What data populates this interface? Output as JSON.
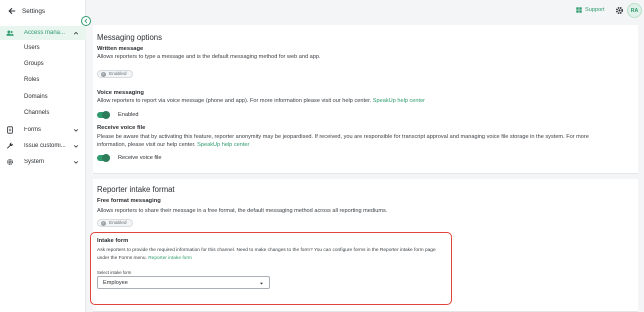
{
  "sidebar": {
    "back_label": "Settings",
    "items": [
      {
        "label": "Access mana...",
        "icon": "users-icon",
        "expanded": true
      },
      {
        "label": "Forms",
        "icon": "document-icon"
      },
      {
        "label": "Issue customi...",
        "icon": "wrench-icon"
      },
      {
        "label": "System",
        "icon": "gear-icon"
      }
    ],
    "sub_items": [
      "Users",
      "Groups",
      "Roles",
      "Domains",
      "Channels"
    ]
  },
  "topbar": {
    "support_label": "Support",
    "avatar_initials": "RA"
  },
  "messaging": {
    "title": "Messaging options",
    "written": {
      "title": "Written message",
      "desc": "Allows reporters to type a message and is the default messaging method for web and app.",
      "badge": "Enabled"
    },
    "voice": {
      "title": "Voice messaging",
      "desc": "Allow reporters to report via voice message (phone and app). For more information please visit our help center.",
      "link": "SpeakUp help center",
      "toggle_label": "Enabled"
    },
    "receive": {
      "title": "Receive voice file",
      "desc_line1": "Please be aware that by activating this feature, reporter anonymity may be jeopardised. If received, you are responsible for transcript approval and managing voice file storage in the system. For more",
      "desc_line2": "information, please visit our help center.",
      "link": "SpeakUp help center",
      "toggle_label": "Receive voice file"
    }
  },
  "intake_format": {
    "title": "Reporter intake format",
    "free": {
      "title": "Free format messaging",
      "desc": "Allows reporters to share their message in a free format, the default messaging method across all reporting mediums.",
      "badge": "Enabled"
    },
    "intake_form": {
      "title": "Intake form",
      "desc": "Ask reporters to provide the required information for this channel. Need to make changes to the form? You can configure forms in the Reporter intake form page under the Forms menu.",
      "link": "Reporter intake form",
      "select_label": "Select intake form",
      "select_value": "Employee"
    }
  },
  "colors": {
    "accent": "#2e9b6e",
    "highlight": "#e0443a"
  }
}
